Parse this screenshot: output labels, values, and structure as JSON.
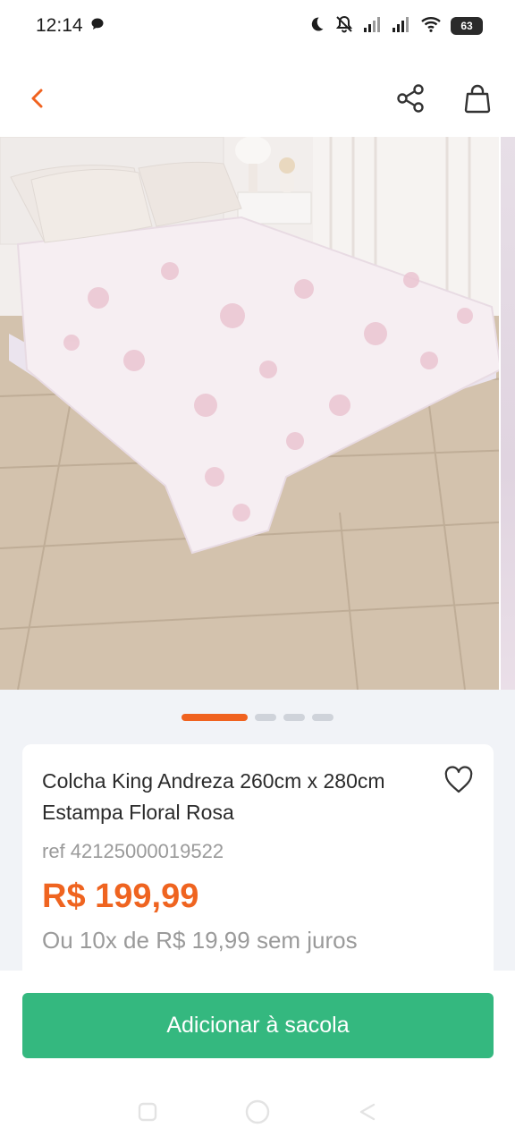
{
  "status_bar": {
    "time": "12:14",
    "battery": "63"
  },
  "nav": {
    "back_icon": "chevron-left-icon",
    "share_icon": "share-icon",
    "bag_icon": "shopping-bag-icon"
  },
  "carousel": {
    "total": 4,
    "active_index": 0
  },
  "product": {
    "title": "Colcha King Andreza 260cm x 280cm Estampa Floral Rosa",
    "ref": "ref 42125000019522",
    "price": "R$ 199,99",
    "installments": "Ou 10x de R$ 19,99 sem juros",
    "favorite_icon": "heart-outline-icon"
  },
  "actions": {
    "add_to_bag": "Adicionar à sacola"
  },
  "colors": {
    "accent_orange": "#f0621f",
    "primary_green": "#34b87f",
    "price_orange": "#ef6420"
  }
}
